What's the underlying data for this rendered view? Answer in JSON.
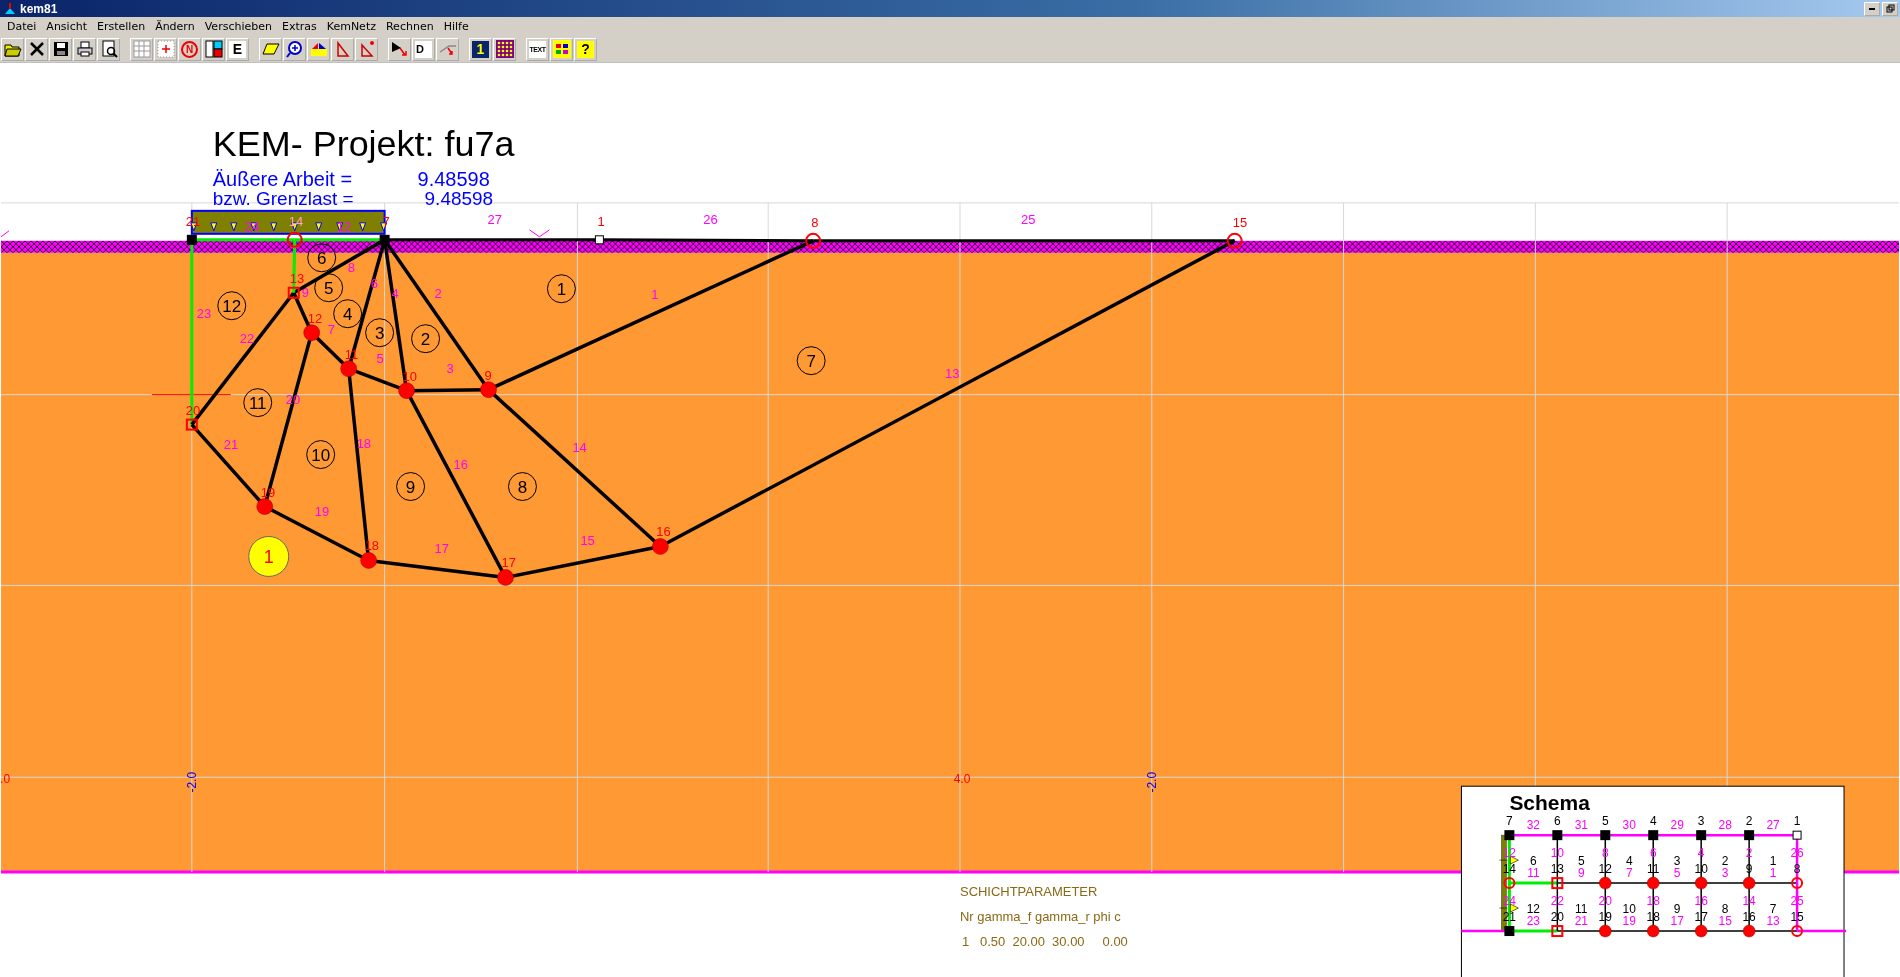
{
  "window": {
    "title": "kem81"
  },
  "menu": [
    "Datei",
    "Ansicht",
    "Erstellen",
    "Ändern",
    "Verschieben",
    "Extras",
    "KemNetz",
    "Rechnen",
    "Hilfe"
  ],
  "toolbar": [
    [
      {
        "kind": "open"
      },
      {
        "kind": "close"
      },
      {
        "kind": "save"
      },
      {
        "kind": "print"
      },
      {
        "kind": "preview"
      }
    ],
    [
      {
        "kind": "grid"
      },
      {
        "kind": "point"
      },
      {
        "kind": "north",
        "label": "N"
      },
      {
        "kind": "panels"
      },
      {
        "kind": "letter",
        "label": "E"
      }
    ],
    [
      {
        "kind": "plane"
      },
      {
        "kind": "zoom"
      },
      {
        "kind": "split"
      },
      {
        "kind": "triangle"
      },
      {
        "kind": "trianglepoint"
      }
    ],
    [
      {
        "kind": "arrow"
      },
      {
        "kind": "letterd",
        "label": "D"
      },
      {
        "kind": "slope"
      }
    ],
    [
      {
        "kind": "number",
        "label": "1"
      },
      {
        "kind": "dots"
      }
    ],
    [
      {
        "kind": "text",
        "label": "TEXT"
      },
      {
        "kind": "colors"
      },
      {
        "kind": "help",
        "label": "?"
      }
    ]
  ],
  "drawing": {
    "title": "KEM- Projekt: fu7a",
    "work": {
      "label": "Äußere Arbeit =",
      "value": "9.48598"
    },
    "limit": {
      "label": "bzw. Grenzlast =",
      "value": "9.48598"
    },
    "nodes": [
      {
        "label": "21",
        "kind": "fixed"
      },
      {
        "label": "14",
        "kind": "ring"
      },
      {
        "label": "7",
        "kind": "fixed"
      },
      {
        "label": "13",
        "kind": "square"
      },
      {
        "label": "12",
        "kind": "dot"
      },
      {
        "label": "11",
        "kind": "dot"
      },
      {
        "label": "10",
        "kind": "dot"
      },
      {
        "label": "9",
        "kind": "dot"
      },
      {
        "label": "20",
        "kind": "square"
      },
      {
        "label": "19",
        "kind": "dot"
      },
      {
        "label": "18",
        "kind": "dot"
      },
      {
        "label": "17",
        "kind": "dot"
      },
      {
        "label": "16",
        "kind": "dot"
      },
      {
        "label": "1",
        "kind": "open"
      },
      {
        "label": "8",
        "kind": "ring"
      },
      {
        "label": "15",
        "kind": "ring"
      }
    ],
    "edges": [
      {
        "label": "24",
        "kind": "support"
      },
      {
        "label": "12",
        "kind": "support"
      },
      {
        "label": "27",
        "kind": "surface"
      },
      {
        "label": "26",
        "kind": "surface"
      },
      {
        "label": "25",
        "kind": "surface"
      },
      {
        "label": "9",
        "kind": "slip"
      },
      {
        "label": "8",
        "kind": "slip"
      },
      {
        "label": "6",
        "kind": "slip"
      },
      {
        "label": "4",
        "kind": "slip"
      },
      {
        "label": "2",
        "kind": "slip"
      },
      {
        "label": "1",
        "kind": "slip"
      },
      {
        "label": "23",
        "kind": "support"
      },
      {
        "label": "22",
        "kind": "slip"
      },
      {
        "label": "7",
        "kind": "slip"
      },
      {
        "label": "5",
        "kind": "slip"
      },
      {
        "label": "3",
        "kind": "slip"
      },
      {
        "label": "13",
        "kind": "slip"
      },
      {
        "label": "21",
        "kind": "slip"
      },
      {
        "label": "20",
        "kind": "slip"
      },
      {
        "label": "18",
        "kind": "slip"
      },
      {
        "label": "16",
        "kind": "slip"
      },
      {
        "label": "14",
        "kind": "slip"
      },
      {
        "label": "19",
        "kind": "slip"
      },
      {
        "label": "17",
        "kind": "slip"
      },
      {
        "label": "15",
        "kind": "slip"
      },
      {
        "kind": "support"
      }
    ],
    "elements": [
      "1",
      "2",
      "3",
      "4",
      "5",
      "6",
      "7",
      "8",
      "9",
      "10",
      "11",
      "12"
    ],
    "layer_marker": "1",
    "axis_labels": [
      {
        "label": ".0",
        "kind": "x"
      },
      {
        "label": "-2.0",
        "kind": "y"
      },
      {
        "label": "4.0",
        "kind": "x"
      },
      {
        "label": "-2.0",
        "kind": "y"
      }
    ]
  },
  "layer_table": {
    "title": "SCHICHTPARAMETER",
    "header": "Nr gamma_f gamma_r phi c",
    "row": "1   0.50  20.00  30.00     0.00"
  },
  "schema": {
    "title": "Schema",
    "top_nodes": [
      {
        "label": "7",
        "kind": "fixed"
      },
      {
        "label": "6",
        "kind": "fixed"
      },
      {
        "label": "5",
        "kind": "fixed"
      },
      {
        "label": "4",
        "kind": "fixed"
      },
      {
        "label": "3",
        "kind": "fixed"
      },
      {
        "label": "2",
        "kind": "fixed"
      },
      {
        "label": "1",
        "kind": "open"
      }
    ],
    "top_edges": [
      "32",
      "31",
      "30",
      "29",
      "28",
      "27"
    ],
    "upper_verticals": [
      "12",
      "10",
      "8",
      "6",
      "4",
      "2",
      "26"
    ],
    "upper_elements": [
      "6",
      "5",
      "4",
      "3",
      "2",
      "1"
    ],
    "middle_nodes": [
      {
        "label": "14",
        "kind": "ring"
      },
      {
        "label": "13",
        "kind": "square"
      },
      {
        "label": "12",
        "kind": "dot"
      },
      {
        "label": "11",
        "kind": "dot"
      },
      {
        "label": "10",
        "kind": "dot"
      },
      {
        "label": "9",
        "kind": "dot"
      },
      {
        "label": "8",
        "kind": "ring"
      }
    ],
    "middle_edges": [
      "11",
      "9",
      "7",
      "5",
      "3",
      "1"
    ],
    "lower_verticals": [
      "24",
      "22",
      "20",
      "18",
      "16",
      "14",
      "25"
    ],
    "lower_elements": [
      "12",
      "11",
      "10",
      "9",
      "8",
      "7"
    ],
    "bottom_nodes": [
      {
        "label": "21",
        "kind": "fixed"
      },
      {
        "label": "20",
        "kind": "square"
      },
      {
        "label": "19",
        "kind": "dot"
      },
      {
        "label": "18",
        "kind": "dot"
      },
      {
        "label": "17",
        "kind": "dot"
      },
      {
        "label": "16",
        "kind": "dot"
      },
      {
        "label": "15",
        "kind": "ring"
      }
    ],
    "bottom_edges": [
      "23",
      "21",
      "19",
      "17",
      "15",
      "13"
    ]
  }
}
